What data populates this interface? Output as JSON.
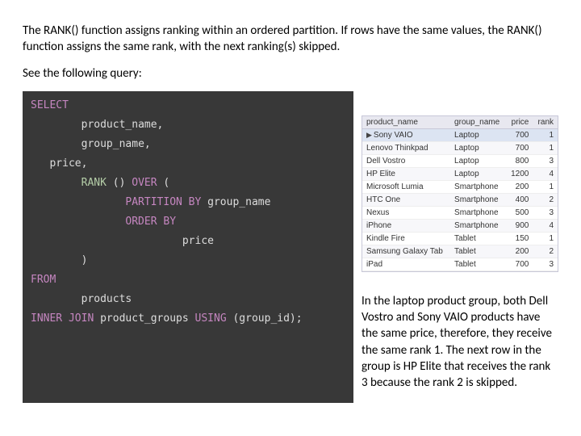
{
  "paragraph1": "The RANK() function assigns ranking within an ordered partition. If rows have the same values, the  RANK() function assigns the same rank, with the next ranking(s) skipped.",
  "paragraph2": "See the following query:",
  "code": {
    "l1a": "SELECT",
    "l2": "product_name,",
    "l3": "group_name,",
    "l4": "price,",
    "l5a": "RANK",
    "l5b": " () ",
    "l5c": "OVER",
    "l5d": " (",
    "l6a": "PARTITION BY",
    "l6b": " group_name",
    "l7": "ORDER BY",
    "l8": "price",
    "l9": ")",
    "l10": "FROM",
    "l11": "products",
    "l12a": "INNER JOIN",
    "l12b": " product_groups ",
    "l12c": "USING",
    "l12d": " (group_id);"
  },
  "table": {
    "headers": [
      "product_name",
      "group_name",
      "price",
      "rank"
    ],
    "rows": [
      {
        "p": "Sony VAIO",
        "g": "Laptop",
        "pr": "700",
        "r": "1",
        "sel": true
      },
      {
        "p": "Lenovo Thinkpad",
        "g": "Laptop",
        "pr": "700",
        "r": "1"
      },
      {
        "p": "Dell Vostro",
        "g": "Laptop",
        "pr": "800",
        "r": "3"
      },
      {
        "p": "HP Elite",
        "g": "Laptop",
        "pr": "1200",
        "r": "4"
      },
      {
        "p": "Microsoft Lumia",
        "g": "Smartphone",
        "pr": "200",
        "r": "1"
      },
      {
        "p": "HTC One",
        "g": "Smartphone",
        "pr": "400",
        "r": "2"
      },
      {
        "p": "Nexus",
        "g": "Smartphone",
        "pr": "500",
        "r": "3"
      },
      {
        "p": "iPhone",
        "g": "Smartphone",
        "pr": "900",
        "r": "4"
      },
      {
        "p": "Kindle Fire",
        "g": "Tablet",
        "pr": "150",
        "r": "1"
      },
      {
        "p": "Samsung Galaxy Tab",
        "g": "Tablet",
        "pr": "200",
        "r": "2"
      },
      {
        "p": "iPad",
        "g": "Tablet",
        "pr": "700",
        "r": "3"
      }
    ]
  },
  "explain": "In the laptop product group, both Dell Vostro and Sony VAIO products have the same price, therefore, they receive the same rank 1. The next row in the group is HP Elite that receives the rank 3 because the rank 2 is skipped."
}
